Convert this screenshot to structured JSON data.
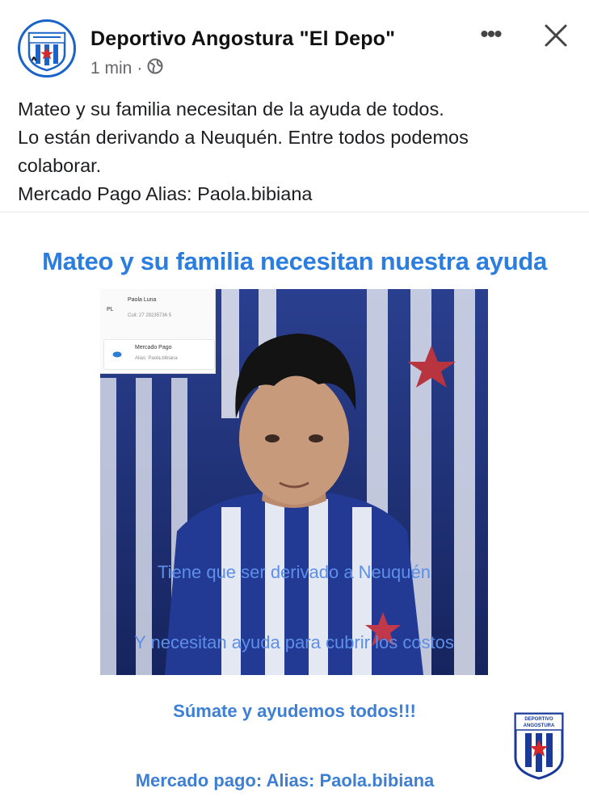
{
  "post": {
    "page_name": "Deportivo Angostura \"El Depo\"",
    "time": "1 min",
    "separator": "·",
    "audience_icon": "globe-icon",
    "more_icon": "more-horizontal-icon",
    "more_label": "•••",
    "close_icon": "close-icon",
    "caption_lines": [
      "Mateo y su familia necesitan de la ayuda de todos.",
      "Lo están derivando a Neuquén. Entre todos podemos",
      "colaborar.",
      "Mercado Pago Alias: Paola.bibiana"
    ]
  },
  "flyer": {
    "title": "Mateo y su familia necesitan nuestra ayuda",
    "photo_card": {
      "initials": "PL",
      "name": "Paola Luna",
      "cuit": "Cuit: 27 29235736 5",
      "service": "Mercado Pago",
      "alias_small": "Alias: Paola.bibiana"
    },
    "overlay_line1": "Tiene que ser derivado a Neuquén",
    "overlay_line2": "Y necesitan ayuda para cubrir los costos",
    "cta": "Súmate y ayudemos todos!!!",
    "alias": "Mercado pago: Alias: Paola.bibiana",
    "crest_text_top": "DEPORTIVO",
    "crest_text_mid": "ANGOSTURA"
  },
  "colors": {
    "brand_blue": "#1a63c9",
    "flyer_blue": "#2b7de0",
    "muted": "#65676b",
    "crest_red": "#d62828"
  }
}
